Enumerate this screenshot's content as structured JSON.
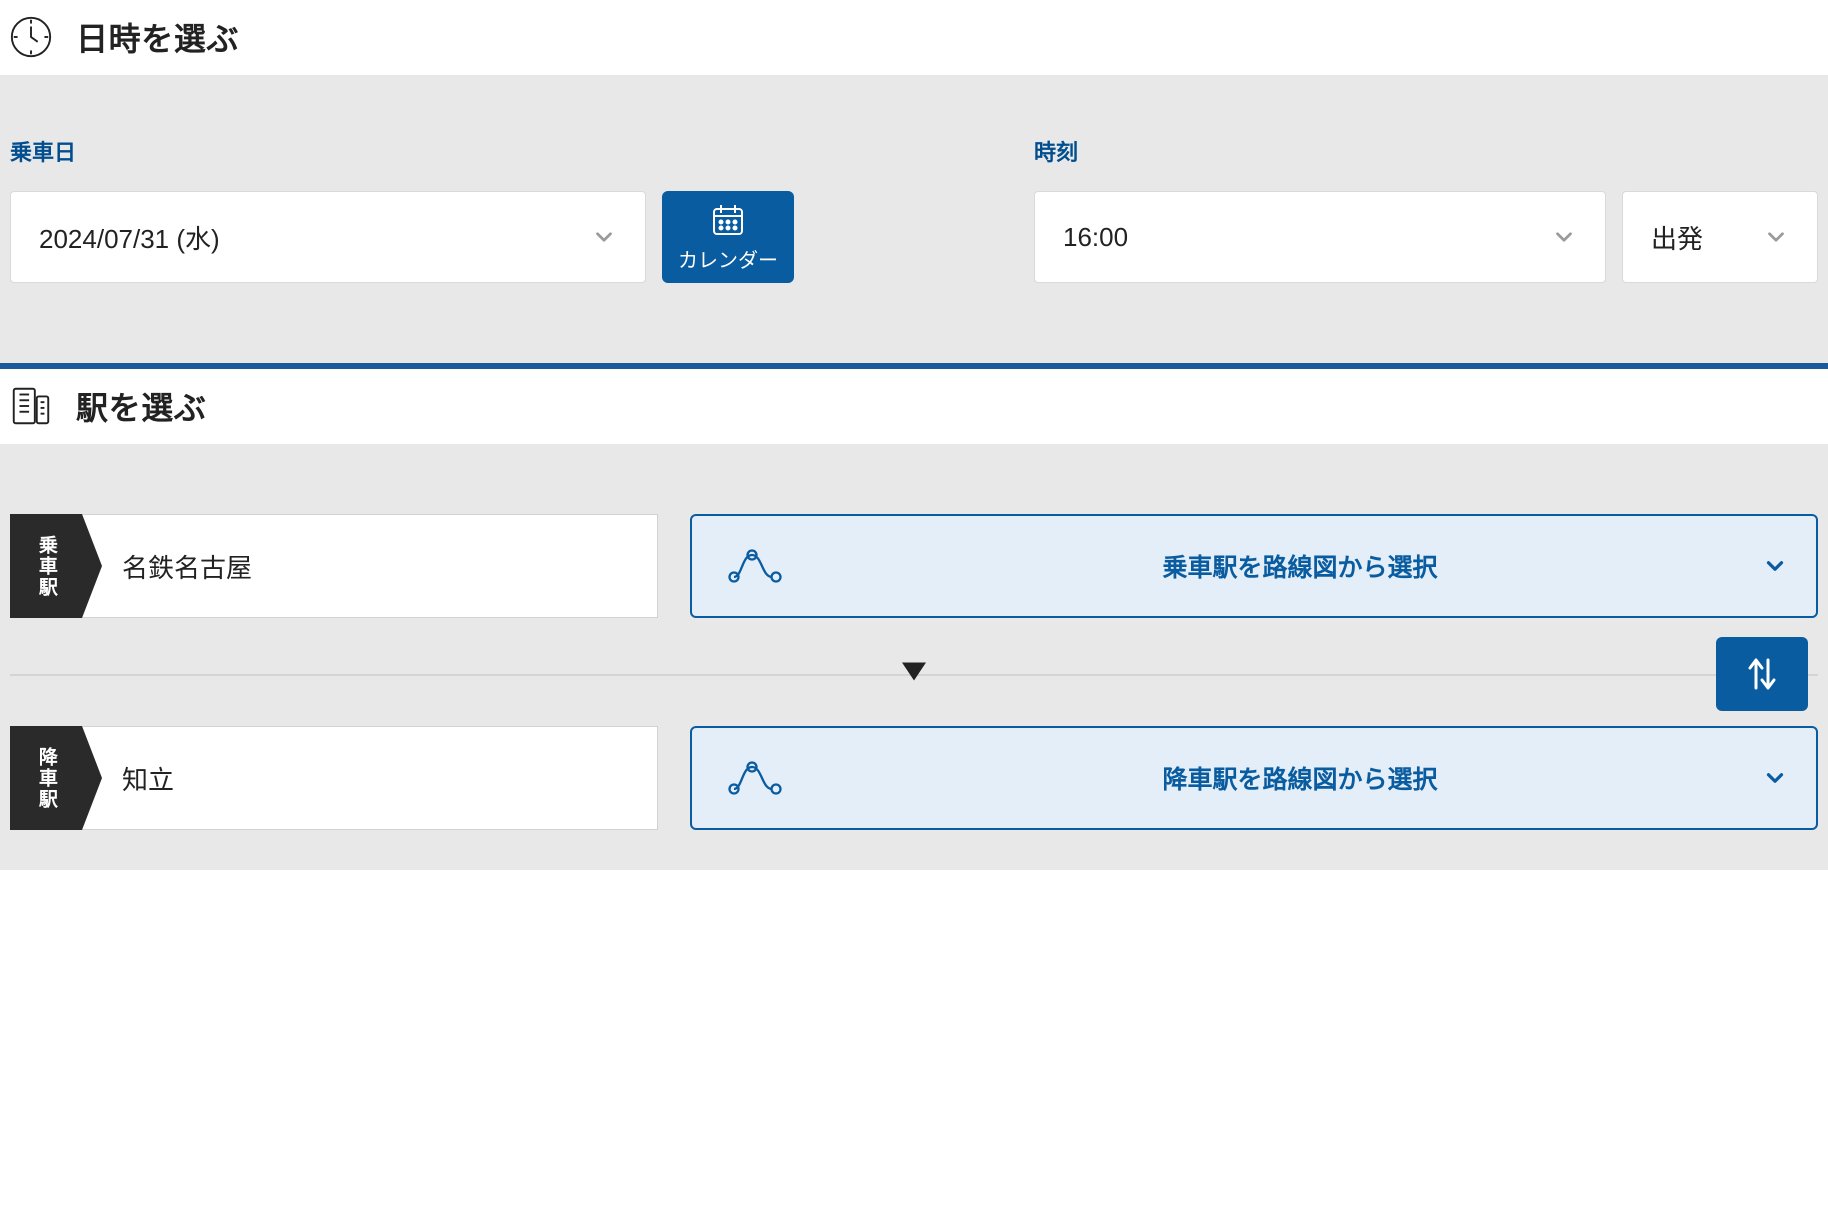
{
  "datetime_section": {
    "title": "日時を選ぶ",
    "date_group": {
      "label": "乗車日",
      "value": "2024/07/31 (水)",
      "calendar_label": "カレンダー"
    },
    "time_group": {
      "label": "時刻",
      "time_value": "16:00",
      "type_value": "出発"
    }
  },
  "station_section": {
    "title": "駅を選ぶ",
    "boarding": {
      "tag": "乗車駅",
      "value": "名鉄名古屋",
      "choose_label": "乗車駅を路線図から選択"
    },
    "alighting": {
      "tag": "降車駅",
      "value": "知立",
      "choose_label": "降車駅を路線図から選択"
    }
  }
}
